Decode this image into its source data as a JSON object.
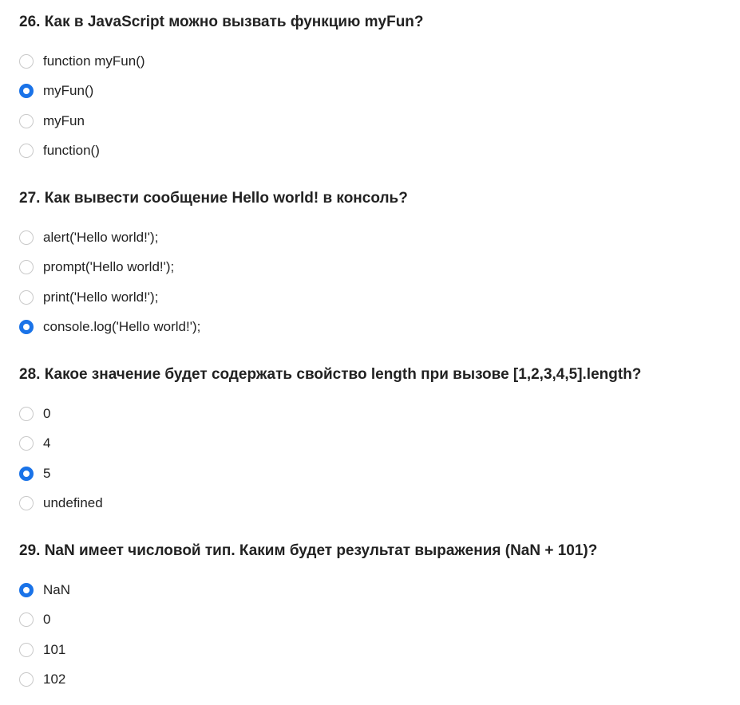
{
  "questions": [
    {
      "title": "26. Как в JavaScript можно вызвать функцию myFun?",
      "options": [
        {
          "label": "function myFun()",
          "selected": false
        },
        {
          "label": "myFun()",
          "selected": true
        },
        {
          "label": "myFun",
          "selected": false
        },
        {
          "label": "function()",
          "selected": false
        }
      ]
    },
    {
      "title": "27. Как вывести сообщение Hello world! в консоль?",
      "options": [
        {
          "label": "alert('Hello world!');",
          "selected": false
        },
        {
          "label": "prompt('Hello world!');",
          "selected": false
        },
        {
          "label": "print('Hello world!');",
          "selected": false
        },
        {
          "label": "console.log('Hello world!');",
          "selected": true
        }
      ]
    },
    {
      "title": "28. Какое значение будет содержать свойство length при вызове [1,2,3,4,5].length?",
      "options": [
        {
          "label": "0",
          "selected": false
        },
        {
          "label": "4",
          "selected": false
        },
        {
          "label": "5",
          "selected": true
        },
        {
          "label": "undefined",
          "selected": false
        }
      ]
    },
    {
      "title": "29. NaN имеет числовой тип. Каким будет результат выражения (NaN + 101)?",
      "options": [
        {
          "label": "NaN",
          "selected": true
        },
        {
          "label": "0",
          "selected": false
        },
        {
          "label": "101",
          "selected": false
        },
        {
          "label": "102",
          "selected": false
        }
      ]
    }
  ],
  "colors": {
    "radio_checked": "#1a73e8",
    "radio_border": "#c9c9c9",
    "text": "#222222"
  }
}
